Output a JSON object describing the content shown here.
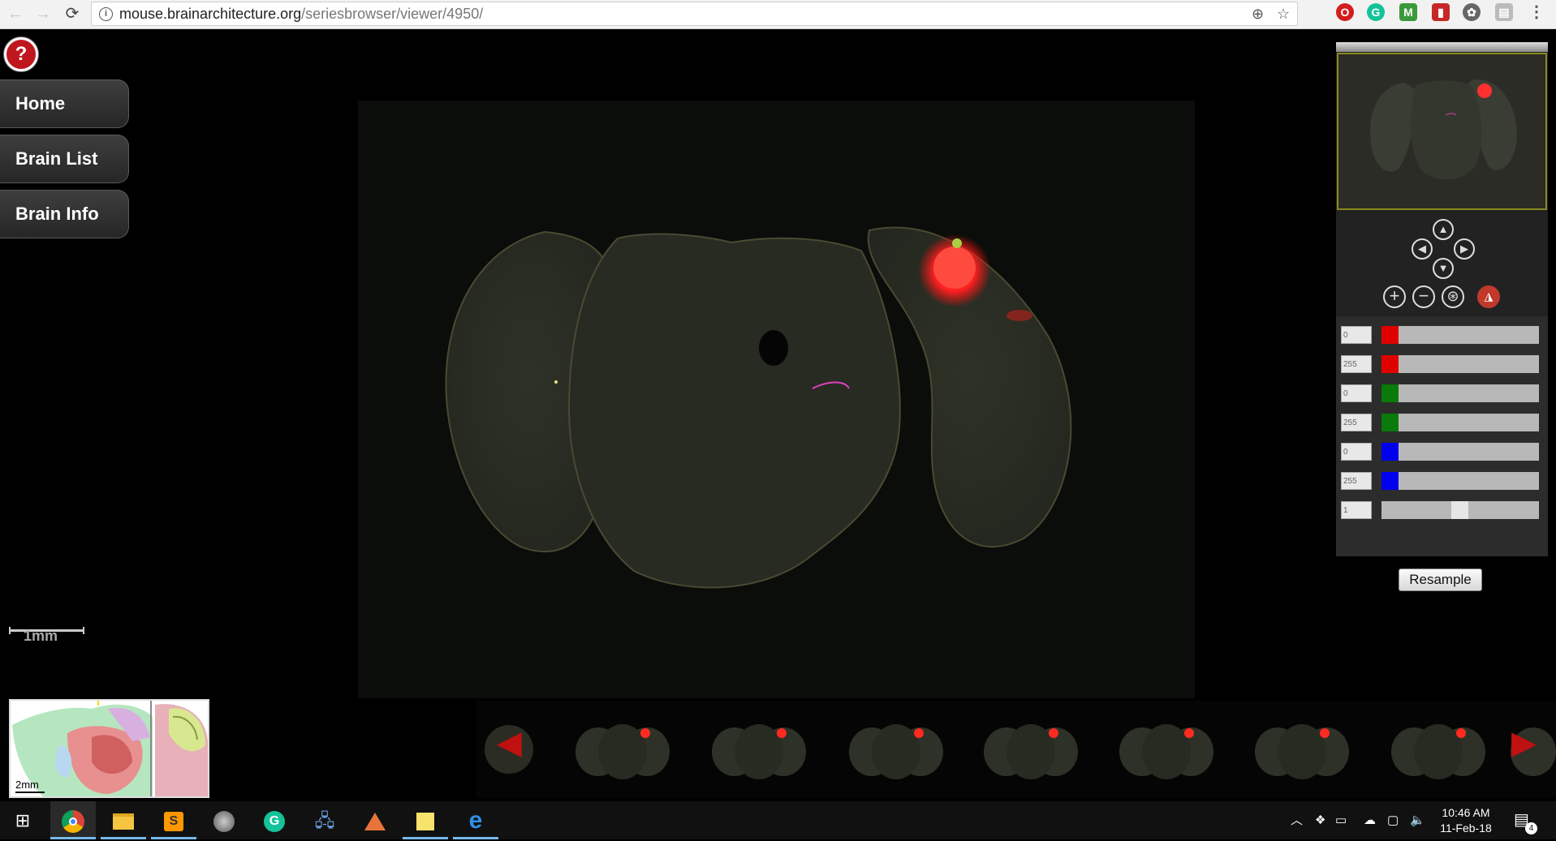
{
  "browser": {
    "url_host": "mouse.brainarchitecture.org",
    "url_path": "/seriesbrowser/viewer/4950/"
  },
  "menu": {
    "help_label": "?",
    "items": [
      {
        "label": "Home"
      },
      {
        "label": "Brain List"
      },
      {
        "label": "Brain Info"
      }
    ]
  },
  "scalebar": {
    "label": "1mm"
  },
  "atlas": {
    "scale_label": "2mm"
  },
  "controls": {
    "pan_up": "▲",
    "pan_left": "◀",
    "pan_right": "▶",
    "pan_down": "▼",
    "zoom_in": "+",
    "zoom_out": "−"
  },
  "channels": [
    {
      "value": "0",
      "color": "#e00000"
    },
    {
      "value": "255",
      "color": "#e00000"
    },
    {
      "value": "0",
      "color": "#0a7a0a"
    },
    {
      "value": "255",
      "color": "#0a7a0a"
    },
    {
      "value": "0",
      "color": "#0000ee"
    },
    {
      "value": "255",
      "color": "#0000ee"
    },
    {
      "value": "1",
      "color": "#e6e6e6"
    }
  ],
  "resample_label": "Resample",
  "taskbar": {
    "time": "10:46 AM",
    "date": "11-Feb-18",
    "notification_count": "4"
  }
}
